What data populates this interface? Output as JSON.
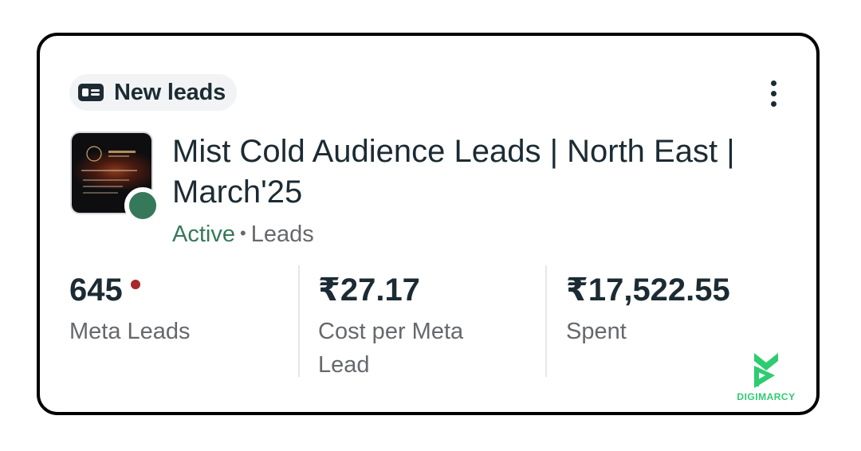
{
  "badge": {
    "label": "New leads",
    "icon": "id-card-icon"
  },
  "menu": {
    "icon": "more-vertical-icon"
  },
  "campaign": {
    "title": "Mist Cold Audience Leads | North East | March'25",
    "status": "Active",
    "separator": "•",
    "objective": "Leads",
    "status_color": "#36795a"
  },
  "metrics": [
    {
      "value": "645",
      "label": "Meta Leads"
    },
    {
      "value": "₹27.17",
      "label": "Cost per Meta Lead"
    },
    {
      "value": "₹17,522.55",
      "label": "Spent"
    }
  ],
  "watermark": {
    "text": "DIGIMARCY",
    "color": "#2ecc71"
  },
  "colors": {
    "text_primary": "#1c2b33",
    "text_secondary": "#65686c",
    "active_green": "#36795a",
    "alert_red": "#a52a2a"
  }
}
